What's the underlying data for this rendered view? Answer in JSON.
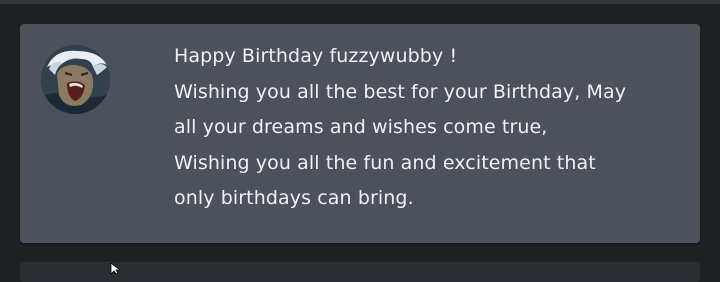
{
  "message": {
    "author_avatar_icon": "avatar-image",
    "lines": [
      "Happy Birthday fuzzywubby !",
      "Wishing you all the best for your Birthday, May",
      "all your dreams and wishes come true,",
      "Wishing you all the fun and excitement that",
      "only birthdays can bring."
    ]
  },
  "colors": {
    "page_background": "#1f2024",
    "card_background": "#4d515c",
    "text": "#eef0f4"
  }
}
